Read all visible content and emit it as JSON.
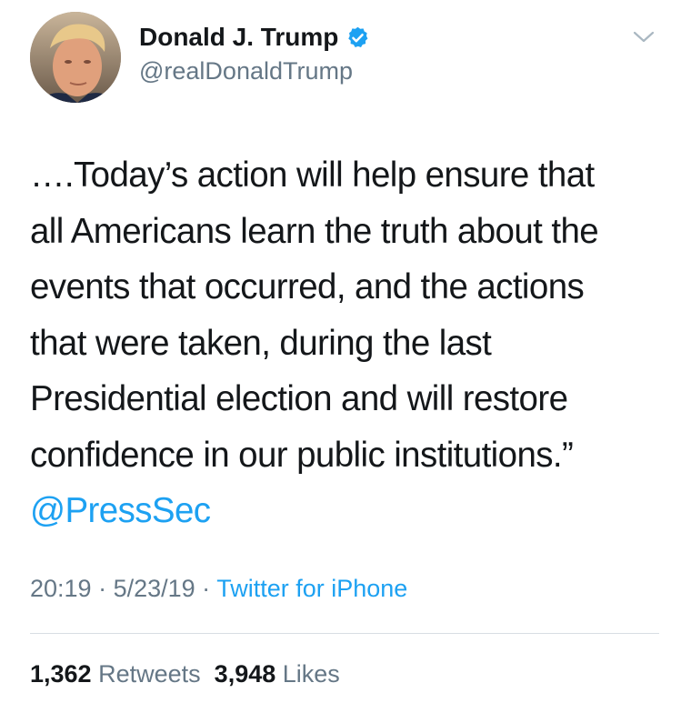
{
  "user": {
    "display_name": "Donald J. Trump",
    "handle": "@realDonaldTrump",
    "verified": true,
    "avatar_icon": "profile-photo"
  },
  "tweet": {
    "lines": [
      "….Today’s action will help ensure that",
      "all Americans learn the truth about the",
      "events that occurred, and the actions",
      "that were taken, during the last",
      "Presidential election and will restore",
      "confidence in our public institutions.”"
    ],
    "mention": "@PressSec"
  },
  "meta": {
    "time": "20:19",
    "separator1": " · ",
    "date": "5/23/19",
    "separator2": " · ",
    "source": "Twitter for iPhone"
  },
  "stats": {
    "retweets_count": "1,362",
    "retweets_label": "Retweets",
    "likes_count": "3,948",
    "likes_label": "Likes"
  },
  "colors": {
    "accent": "#1da1f2",
    "text": "#14171a",
    "secondary": "#657786",
    "divider": "#d8dee3"
  }
}
